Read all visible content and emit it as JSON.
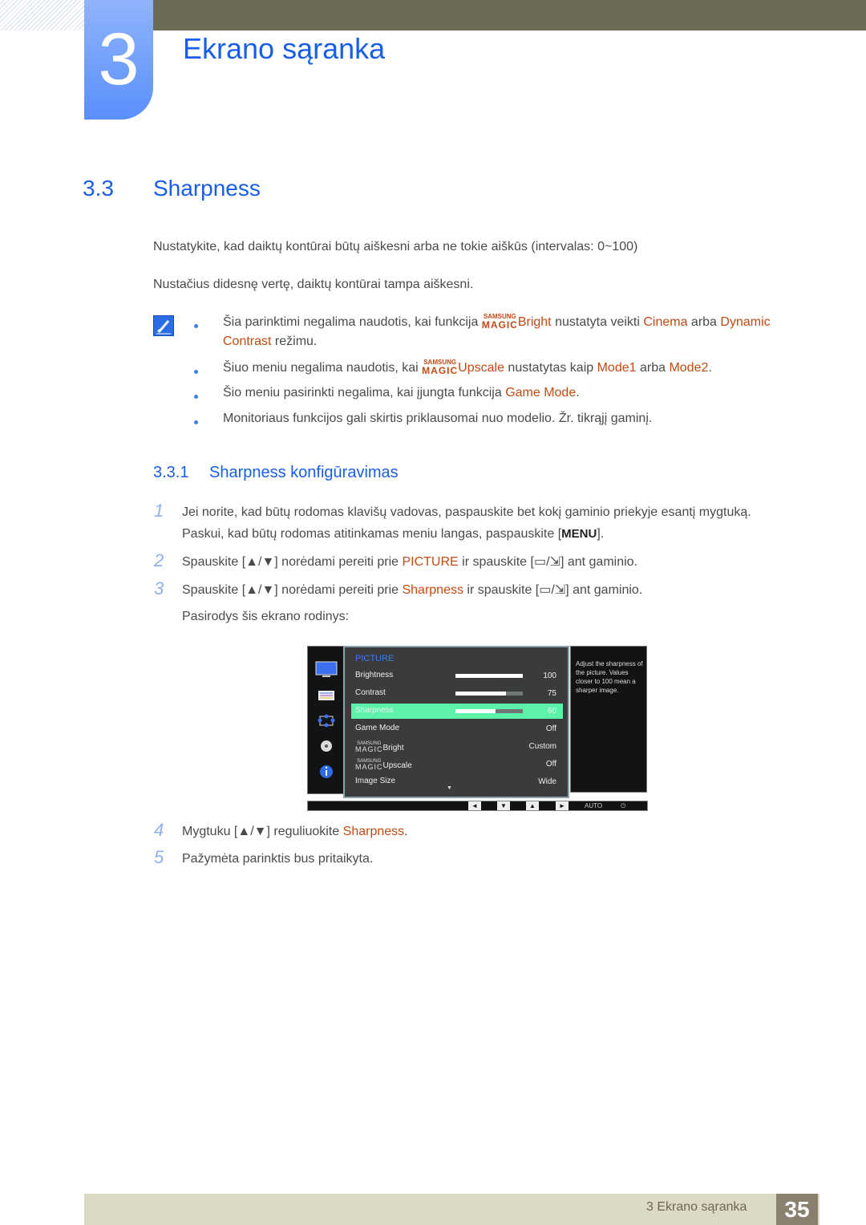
{
  "chapter": {
    "number": "3",
    "title": "Ekrano sąranka"
  },
  "section": {
    "number": "3.3",
    "title": "Sharpness"
  },
  "intro": [
    "Nustatykite, kad daiktų kontūrai būtų aiškesni arba ne tokie aiškūs (intervalas: 0~100)",
    "Nustačius didesnę vertę, daiktų kontūrai tampa aiškesni."
  ],
  "magic_logo": {
    "top": "SAMSUNG",
    "bottom": "MAGIC"
  },
  "notes": {
    "n1": {
      "a": "Šia parinktimi negalima naudotis, kai funkcija ",
      "b": "Bright",
      "c": " nustatyta veikti ",
      "d": "Cinema",
      "e": " arba ",
      "f": "Dynamic Contrast",
      "g": " režimu."
    },
    "n2": {
      "a": "Šiuo meniu negalima naudotis, kai ",
      "b": "Upscale",
      "c": " nustatytas kaip ",
      "d": "Mode1",
      "e": " arba ",
      "f": "Mode2",
      "g": "."
    },
    "n3": {
      "a": "Šio meniu pasirinkti negalima, kai įjungta funkcija ",
      "b": "Game Mode",
      "c": "."
    },
    "n4": {
      "a": "Monitoriaus funkcijos gali skirtis priklausomai nuo modelio. Žr. tikrąjį gaminį."
    }
  },
  "subsection": {
    "number": "3.3.1",
    "title": "Sharpness konfigūravimas"
  },
  "steps": {
    "s1": {
      "num": "1",
      "line1": "Jei norite, kad būtų rodomas klavišų vadovas, paspauskite bet kokį gaminio priekyje esantį mygtuką.",
      "line2a": "Paskui, kad būtų rodomas atitinkamas meniu langas, paspauskite [",
      "key": "MENU",
      "line2b": "]."
    },
    "s2": {
      "num": "2",
      "a": "Spauskite [▲/▼] norėdami pereiti prie ",
      "b": "PICTURE",
      "c": " ir spauskite [",
      "d": "] ant gaminio."
    },
    "s3": {
      "num": "3",
      "a": "Spauskite [▲/▼] norėdami pereiti prie ",
      "b": "Sharpness",
      "c": " ir spauskite [",
      "d": "] ant gaminio.",
      "e": "Pasirodys šis ekrano rodinys:"
    },
    "s4": {
      "num": "4",
      "a": "Mygtuku [▲/▼] reguliuokite ",
      "b": "Sharpness",
      "c": "."
    },
    "s5": {
      "num": "5",
      "a": "Pažymėta parinktis bus pritaikyta."
    }
  },
  "osd": {
    "category": "PICTURE",
    "rows": [
      {
        "label": "Brightness",
        "value": "100",
        "bar": 1.0
      },
      {
        "label": "Contrast",
        "value": "75",
        "bar": 0.75
      },
      {
        "label": "Sharpness",
        "value": "60",
        "bar": 0.6,
        "selected": true
      },
      {
        "label": "Game Mode",
        "value": "Off"
      },
      {
        "label": "Bright",
        "value": "Custom",
        "magic": true
      },
      {
        "label": "Upscale",
        "value": "Off",
        "magic": true
      },
      {
        "label": "Image Size",
        "value": "Wide"
      }
    ],
    "help": "Adjust the sharpness of the picture. Values closer to 100 mean a sharper image.",
    "bottom_buttons": [
      "◄",
      "▼",
      "▲",
      "►",
      "AUTO",
      "⏻"
    ]
  },
  "footer": {
    "text": "3 Ekrano sąranka",
    "page": "35"
  }
}
